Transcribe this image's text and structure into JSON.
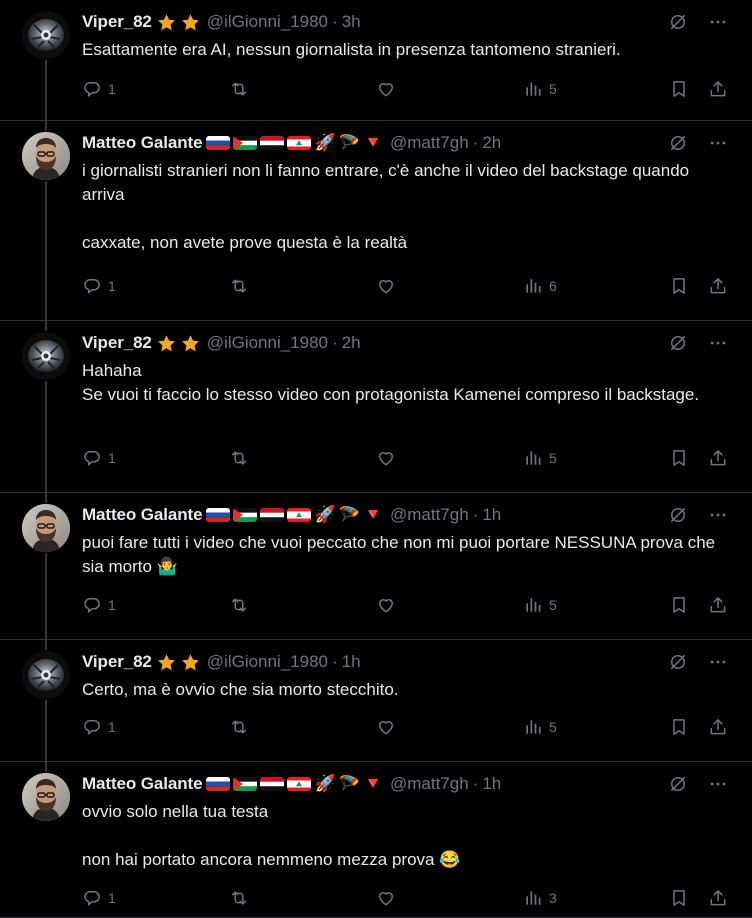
{
  "posts": [
    {
      "author": "Viper_82",
      "author_type": "viper",
      "handle": "@ilGionni_1980",
      "time": "3h",
      "text": "Esattamente era AI, nessun giornalista in presenza tantomeno stranieri.",
      "replies": "1",
      "views": "5"
    },
    {
      "author": "Matteo Galante",
      "author_type": "matteo",
      "handle": "@matt7gh",
      "time": "2h",
      "text": "i giornalisti stranieri non li fanno entrare, c'è anche il video del backstage quando arriva\n\ncaxxate, non avete prove questa è la realtà",
      "replies": "1",
      "views": "6"
    },
    {
      "author": "Viper_82",
      "author_type": "viper",
      "handle": "@ilGionni_1980",
      "time": "2h",
      "text": "Hahaha\nSe vuoi ti faccio lo stesso video con protagonista Kamenei compreso il backstage.",
      "replies": "1",
      "views": "5"
    },
    {
      "author": "Matteo Galante",
      "author_type": "matteo",
      "handle": "@matt7gh",
      "time": "1h",
      "text": "puoi fare tutti i video che vuoi peccato che non mi puoi portare NESSUNA prova che sia morto 🤷‍♂️",
      "replies": "1",
      "views": "5"
    },
    {
      "author": "Viper_82",
      "author_type": "viper",
      "handle": "@ilGionni_1980",
      "time": "1h",
      "text": "Certo, ma è ovvio che sia morto stecchito.",
      "replies": "1",
      "views": "5"
    },
    {
      "author": "Matteo Galante",
      "author_type": "matteo",
      "handle": "@matt7gh",
      "time": "1h",
      "text": "ovvio solo nella tua testa\n\nnon hai portato ancora nemmeno mezza prova 😂",
      "replies": "1",
      "views": "3"
    }
  ],
  "badges": {
    "viper": [
      "star-icon",
      "star-icon"
    ],
    "matteo": [
      "russia-flag-icon",
      "palestine-flag-icon",
      "yemen-flag-icon",
      "lebanon-flag-icon",
      "rocket-icon",
      "parachute-icon",
      "red-triangle-icon"
    ]
  },
  "emoji": {
    "rocket": "🚀",
    "parachute": "🪂",
    "triangle": "🔻"
  },
  "colors": {
    "background": "#000000",
    "text": "#e7e9ea",
    "muted": "#71767b",
    "divider": "#2f3336",
    "star": "#f4a623"
  }
}
